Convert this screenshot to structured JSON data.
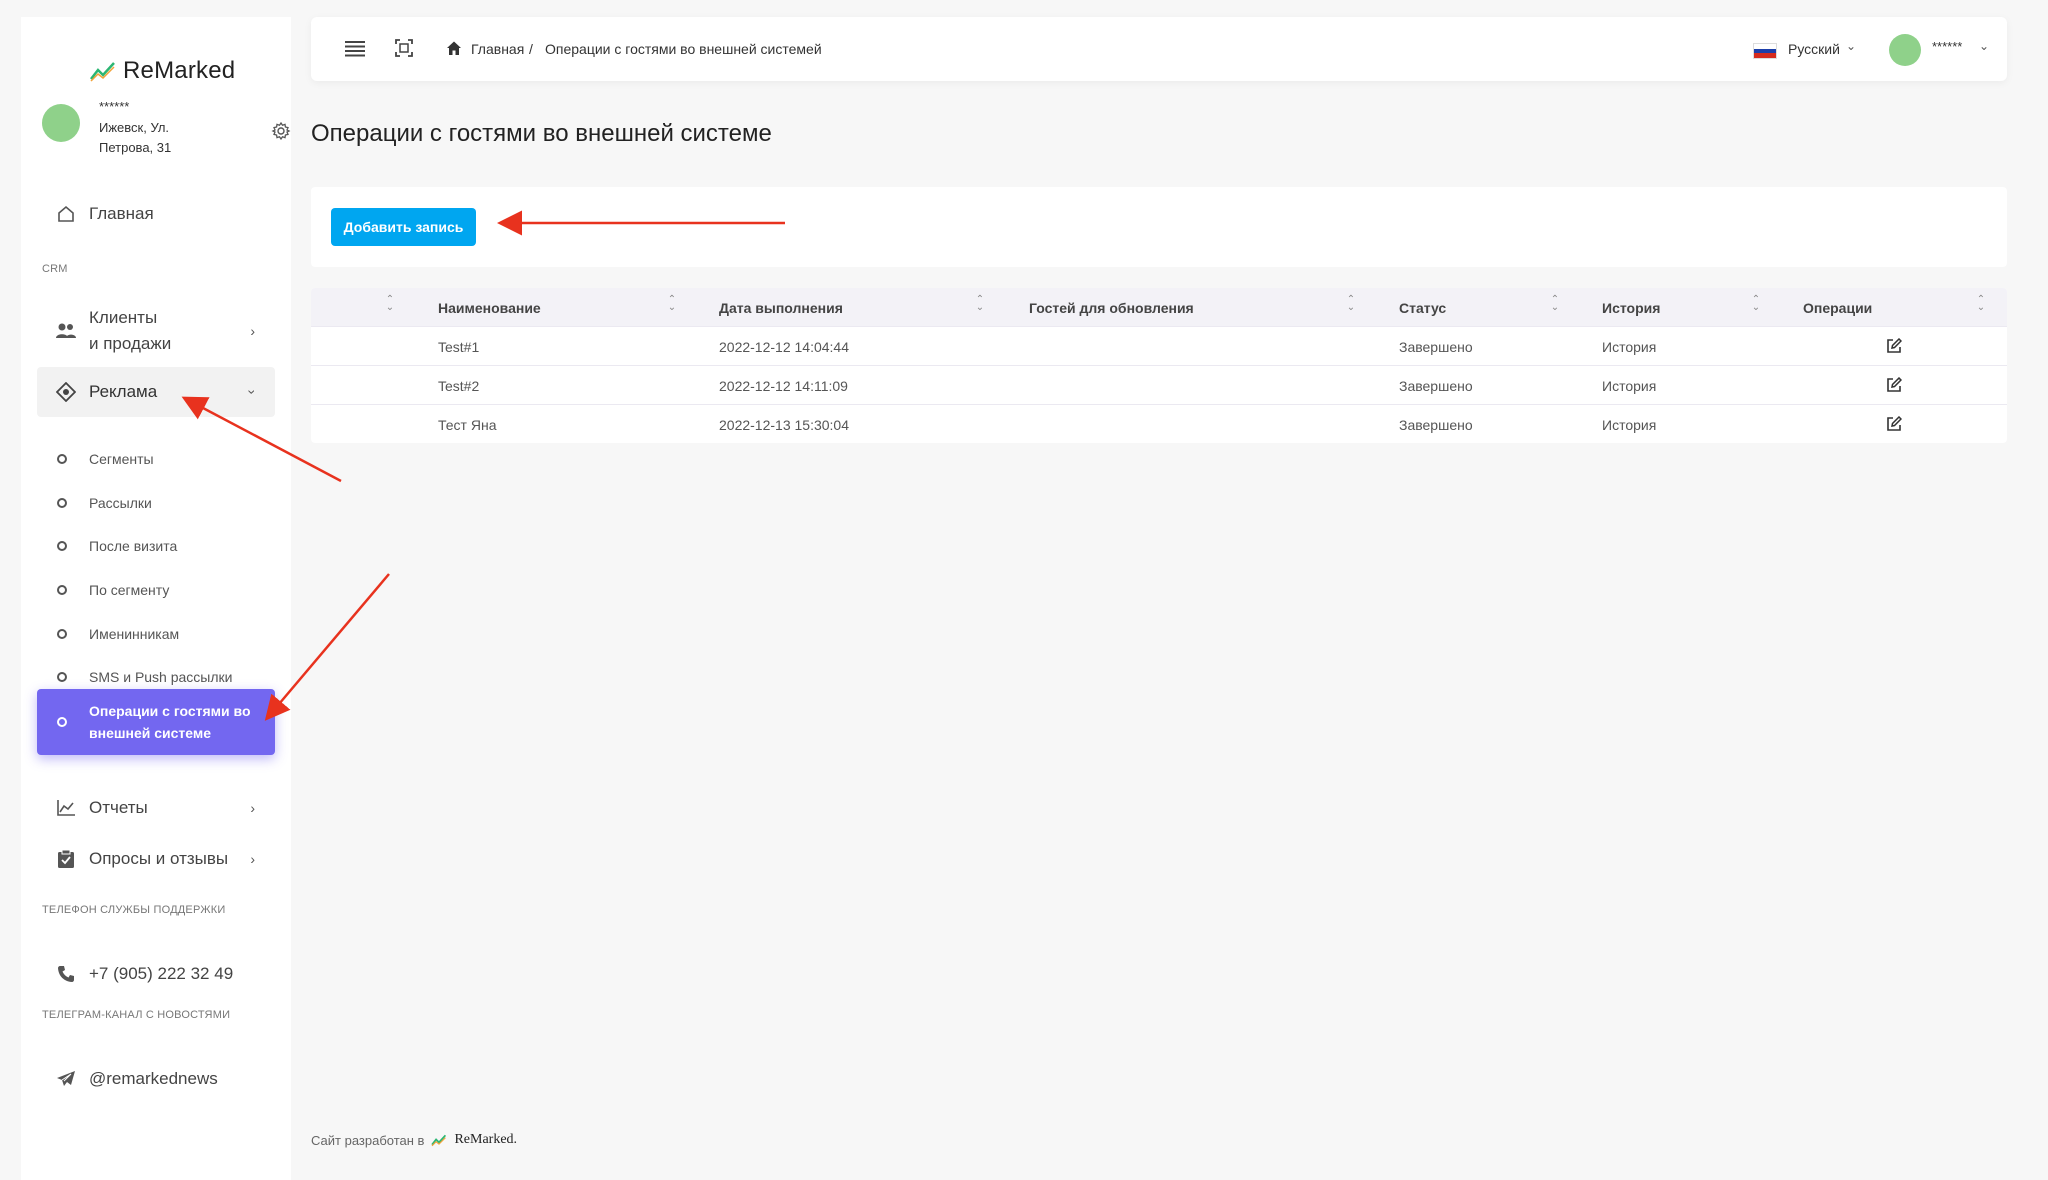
{
  "brand": {
    "name": "ReMarked"
  },
  "profile": {
    "name": "******",
    "address": "Ижевск, Ул. Петрова, 31"
  },
  "sidebar": {
    "home_label": "Главная",
    "section_crm": "CRM",
    "clients_label_line1": "Клиенты",
    "clients_label_line2": "и продажи",
    "ads_label": "Реклама",
    "ads_sub": [
      "Сегменты",
      "Рассылки",
      "После визита",
      "По сегменту",
      "Именинникам",
      "SMS и Push рассылки",
      "Операции с гостями во внешней системе"
    ],
    "reports_label": "Отчеты",
    "surveys_label": "Опросы и отзывы",
    "section_support": "ТЕЛЕФОН СЛУЖБЫ ПОДДЕРЖКИ",
    "support_phone": "+7 (905) 222 32 49",
    "section_telegram": "ТЕЛЕГРАМ-КАНАЛ С НОВОСТЯМИ",
    "telegram_handle": "@remarkednews"
  },
  "navbar": {
    "breadcrumb_home": "Главная",
    "breadcrumb_sep": "/",
    "breadcrumb_current": "Операции с гостями во внешней системей",
    "language": "Русский",
    "user": "******"
  },
  "page": {
    "title": "Операции с гостями во внешней системе",
    "add_button": "Добавить запись"
  },
  "table": {
    "columns": [
      "",
      "Наименование",
      "Дата выполнения",
      "Гостей для обновления",
      "Статус",
      "История",
      "Операции"
    ],
    "rows": [
      {
        "name": "Test#1",
        "date": "2022-12-12 14:04:44",
        "guests": "",
        "status": "Завершено",
        "history": "История"
      },
      {
        "name": "Test#2",
        "date": "2022-12-12 14:11:09",
        "guests": "",
        "status": "Завершено",
        "history": "История"
      },
      {
        "name": "Тест Яна",
        "date": "2022-12-13 15:30:04",
        "guests": "",
        "status": "Завершено",
        "history": "История"
      }
    ]
  },
  "footer": {
    "text": "Сайт разработан в",
    "brand": "ReMarked."
  },
  "colors": {
    "accent": "#7367f0",
    "button": "#00a6f0",
    "arrow": "#e8321e"
  }
}
